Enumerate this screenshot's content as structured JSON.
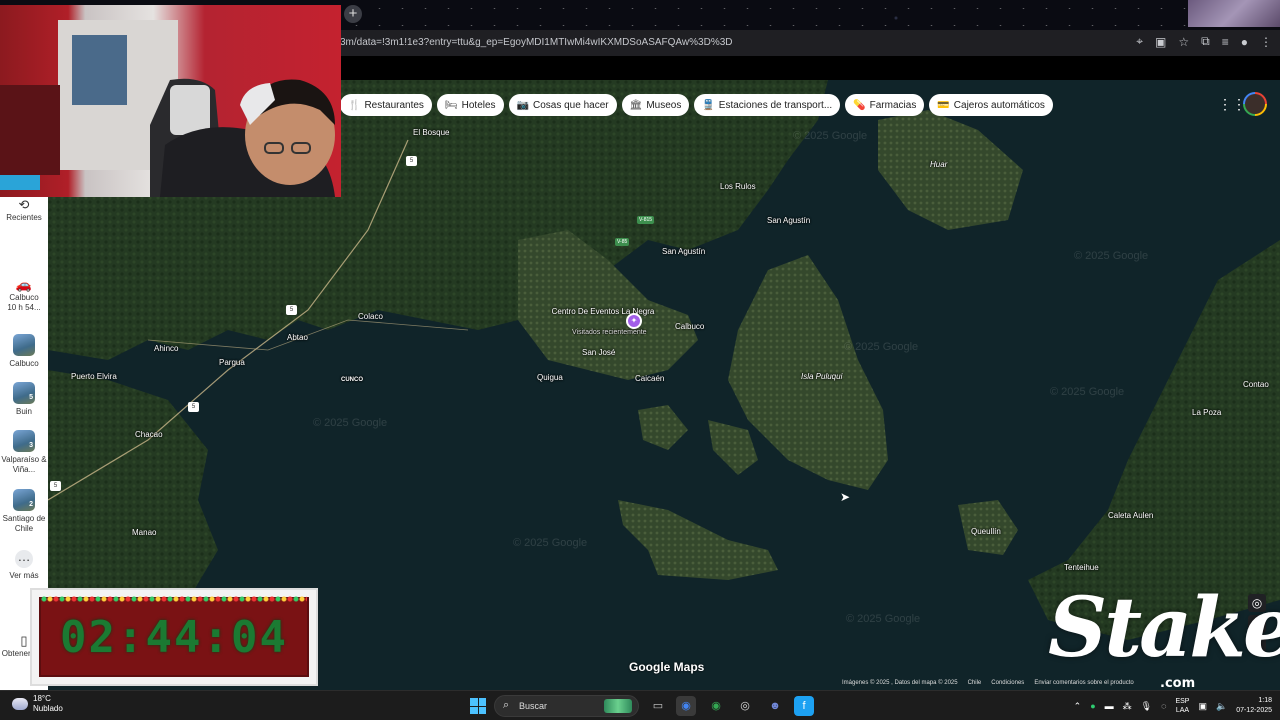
{
  "browser": {
    "new_tab": "+",
    "url": "3m/data=!3m1!1e3?entry=ttu&g_ep=EgoyMDI1MTIwMi4wIKXMDSoASAFQAw%3D%3D"
  },
  "chips": [
    {
      "icon": "restaurant-icon",
      "glyph": "🍴",
      "label": "Restaurantes"
    },
    {
      "icon": "hotel-icon",
      "glyph": "🛏",
      "label": "Hoteles"
    },
    {
      "icon": "camera-icon",
      "glyph": "📷",
      "label": "Cosas que hacer"
    },
    {
      "icon": "museum-icon",
      "glyph": "🏛",
      "label": "Museos"
    },
    {
      "icon": "transit-icon",
      "glyph": "🚆",
      "label": "Estaciones de transport..."
    },
    {
      "icon": "pharmacy-icon",
      "glyph": "💊",
      "label": "Farmacias"
    },
    {
      "icon": "atm-icon",
      "glyph": "💳",
      "label": "Cajeros automáticos"
    }
  ],
  "sidebar": {
    "recent_label": "Recientes",
    "items": [
      {
        "label": "Calbuco",
        "sublabel": "10 h 54...",
        "type": "car"
      },
      {
        "label": "Calbuco",
        "badge": ""
      },
      {
        "label": "Buin",
        "badge": "5"
      },
      {
        "label": "Valparaíso & Viña...",
        "badge": "3"
      },
      {
        "label": "Santiago de Chile",
        "badge": "2"
      }
    ],
    "more_label": "Ver más",
    "get_app_label": "Obtener app"
  },
  "map": {
    "places": [
      {
        "name": "El Bosque"
      },
      {
        "name": "Los Rulos"
      },
      {
        "name": "San Agustín"
      },
      {
        "name": "San Agustín"
      },
      {
        "name": "Huar"
      },
      {
        "name": "Centro De Eventos La Negra"
      },
      {
        "name": "Visitados recientemente"
      },
      {
        "name": "Calbuco"
      },
      {
        "name": "San José"
      },
      {
        "name": "Quigua"
      },
      {
        "name": "Caicaén"
      },
      {
        "name": "Isla Puluqui"
      },
      {
        "name": "Colaco"
      },
      {
        "name": "Ahinco"
      },
      {
        "name": "Abtao"
      },
      {
        "name": "Pargua"
      },
      {
        "name": "CUNCO"
      },
      {
        "name": "Puerto Elvira"
      },
      {
        "name": "Chacao"
      },
      {
        "name": "Manao"
      },
      {
        "name": "Contao"
      },
      {
        "name": "La Poza"
      },
      {
        "name": "Caleta Aulen"
      },
      {
        "name": "Queullín"
      },
      {
        "name": "Tenteihue"
      }
    ],
    "watermark": "© 2025 Google",
    "routes": [
      "5",
      "5",
      "5",
      "5"
    ],
    "route_green": [
      "V-815",
      "V-85"
    ],
    "logo": "Google Maps",
    "attribution": [
      "Imágenes © 2025 , Datos del mapa © 2025",
      "Chile",
      "Condiciones",
      "Enviar comentarios sobre el producto"
    ]
  },
  "timer": {
    "value": "02:44:04"
  },
  "overlay": {
    "brand": "Stake",
    "brand_suffix": ".com"
  },
  "taskbar": {
    "temp": "18°C",
    "weather": "Nublado",
    "search": "Buscar",
    "lang_top": "ESP",
    "lang_bottom": "LAA",
    "time": "1:18",
    "date": "07-12-2025"
  }
}
